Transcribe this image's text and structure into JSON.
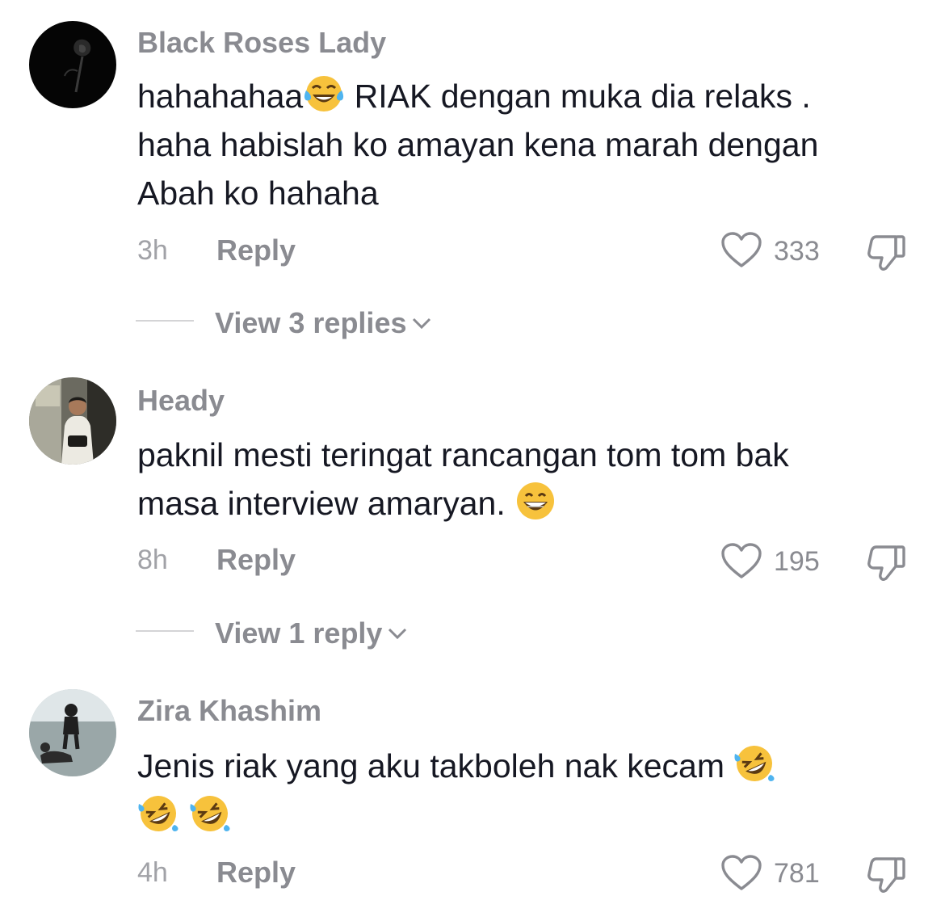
{
  "comments": [
    {
      "username": "Black Roses Lady",
      "text_lines": [
        "hahahahaa",
        " RIAK dengan muka dia relaks .",
        "haha habislah ko amayan kena marah dengan",
        "Abah ko hahaha"
      ],
      "emojis": [
        "tears-of-joy-emoji"
      ],
      "time": "3h",
      "reply_label": "Reply",
      "like_count": "333",
      "view_replies_label": "View 3 replies"
    },
    {
      "username": "Heady",
      "text_lines": [
        "paknil mesti teringat rancangan tom tom bak",
        "masa interview amaryan. "
      ],
      "emojis": [
        "grinning-emoji"
      ],
      "time": "8h",
      "reply_label": "Reply",
      "like_count": "195",
      "view_replies_label": "View 1 reply"
    },
    {
      "username": "Zira Khashim",
      "text_lines": [
        "Jenis riak yang aku takboleh nak kecam "
      ],
      "emojis": [
        "rolling-laughing-emoji",
        "rolling-laughing-emoji",
        "rolling-laughing-emoji"
      ],
      "time": "4h",
      "reply_label": "Reply",
      "like_count": "781"
    }
  ],
  "icons": {
    "like": "heart-outline-icon",
    "dislike": "thumbs-down-outline-icon",
    "expand": "chevron-down-icon"
  },
  "colors": {
    "primary_text": "#161823",
    "secondary_text": "#8a8b91",
    "muted_text": "#a1a2a7",
    "divider": "#d4d4d6",
    "emoji_yellow": "#f7c23c",
    "tear_blue": "#4fb4ef"
  }
}
